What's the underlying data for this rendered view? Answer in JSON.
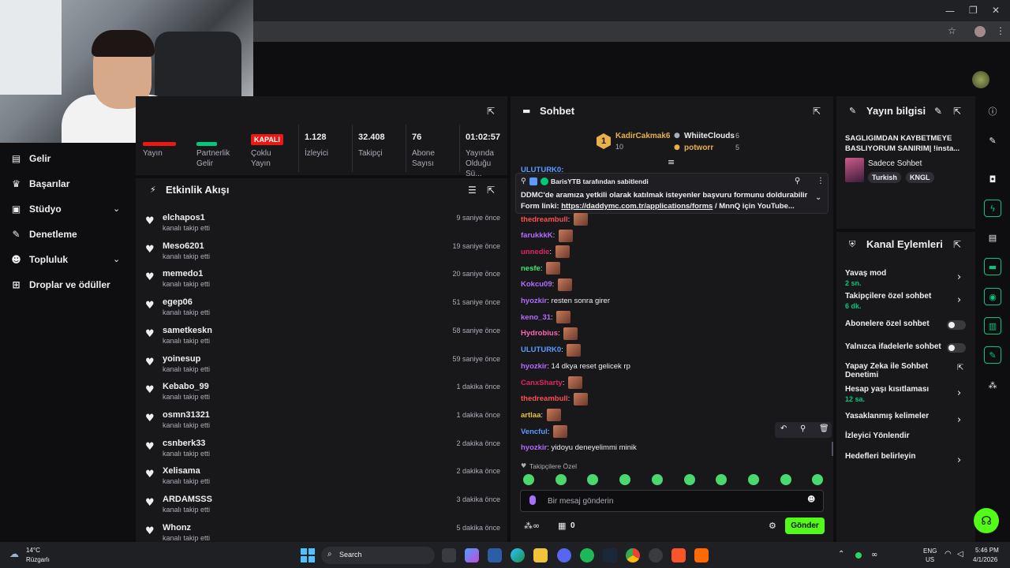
{
  "colors": {
    "accent": "#00c97b",
    "live_red": "#e91916",
    "bg": "#0e0e10",
    "panel": "#18181b"
  },
  "sidebar": {
    "items": [
      {
        "label": "Gelir",
        "icon": "revenue-icon"
      },
      {
        "label": "Başarılar",
        "icon": "trophy-icon"
      },
      {
        "label": "Stüdyo",
        "icon": "studio-icon"
      },
      {
        "label": "Denetleme",
        "icon": "wrench-icon"
      },
      {
        "label": "Topluluk",
        "icon": "community-icon"
      },
      {
        "label": "Droplar ve ödüller",
        "icon": "drops-icon"
      }
    ]
  },
  "stats": {
    "items": [
      {
        "value": "",
        "label": "Yayın"
      },
      {
        "value": "",
        "label": "Partnerlik Gelir"
      },
      {
        "value": "KAPALI",
        "label": "Çoklu Yayın"
      },
      {
        "value": "1.128",
        "label": "İzleyici"
      },
      {
        "value": "32.408",
        "label": "Takipçi"
      },
      {
        "value": "76",
        "label": "Abone Sayısı"
      },
      {
        "value": "01:02:57",
        "label": "Yayında Olduğu Sü..."
      }
    ]
  },
  "activity": {
    "title": "Etkinlik Akışı",
    "rows": [
      {
        "user": "elchapos1",
        "action": "kanalı takip etti",
        "time": "9 saniye önce"
      },
      {
        "user": "Meso6201",
        "action": "kanalı takip etti",
        "time": "19 saniye önce"
      },
      {
        "user": "memedo1",
        "action": "kanalı takip etti",
        "time": "20 saniye önce"
      },
      {
        "user": "egep06",
        "action": "kanalı takip etti",
        "time": "51 saniye önce"
      },
      {
        "user": "sametkeskn",
        "action": "kanalı takip etti",
        "time": "58 saniye önce"
      },
      {
        "user": "yoinesup",
        "action": "kanalı takip etti",
        "time": "59 saniye önce"
      },
      {
        "user": "Kebabo_99",
        "action": "kanalı takip etti",
        "time": "1 dakika önce"
      },
      {
        "user": "osmn31321",
        "action": "kanalı takip etti",
        "time": "1 dakika önce"
      },
      {
        "user": "csnberk33",
        "action": "kanalı takip etti",
        "time": "2 dakika önce"
      },
      {
        "user": "Xelisama",
        "action": "kanalı takip etti",
        "time": "2 dakika önce"
      },
      {
        "user": "ARDAMSSS",
        "action": "kanalı takip etti",
        "time": "3 dakika önce"
      },
      {
        "user": "Whonz",
        "action": "kanalı takip etti",
        "time": "5 dakika önce"
      }
    ]
  },
  "chat": {
    "title": "Sohbet",
    "leaderboard": [
      {
        "rank": "1",
        "name": "KadirCakmak6",
        "count": "10"
      },
      {
        "rank": "",
        "name": "WhiiteClouds",
        "count": "6"
      },
      {
        "rank": "",
        "name": "potworr",
        "count": "5"
      }
    ],
    "pinned": {
      "by": "BarisYTB tarafından sabitlendi",
      "line1": "DDMC'de aramıza yetkili olarak katılmak isteyenler başvuru formunu doldurabilir",
      "prefix": "Form linki: ",
      "link": "https://daddymc.com.tr/applications/forms",
      "suffix": " / MnnQ için YouTube..."
    },
    "hidden_top_user": "ULUTURK0:",
    "messages": [
      {
        "user": "thedreambull",
        "color": "#ff4f4f",
        "text": "",
        "emote": true
      },
      {
        "user": "farukkkK",
        "color": "#b26cff",
        "text": "",
        "emote": true
      },
      {
        "user": "unnedie",
        "color": "#e0245e",
        "text": "",
        "emote": true
      },
      {
        "user": "nesfe",
        "color": "#3be86a",
        "text": "",
        "emote": true
      },
      {
        "user": "Kokcu09",
        "color": "#b26cff",
        "text": "",
        "emote": true
      },
      {
        "user": "hyozkir",
        "color": "#b26cff",
        "text": "resten sonra girer",
        "emote": false
      },
      {
        "user": "keno_31",
        "color": "#b26cff",
        "text": "",
        "emote": true
      },
      {
        "user": "Hydrobius",
        "color": "#ff66b2",
        "text": "",
        "emote": true
      },
      {
        "user": "ULUTURK0",
        "color": "#5b9bff",
        "text": "",
        "emote": true
      },
      {
        "user": "hyozkir",
        "color": "#b26cff",
        "text": "14 dkya reset gelicek rp",
        "emote": false
      },
      {
        "user": "CanxSharty",
        "color": "#e0245e",
        "text": "",
        "emote": true
      },
      {
        "user": "thedreambull",
        "color": "#ff4f4f",
        "text": "",
        "emote": true
      },
      {
        "user": "artlaa",
        "color": "#e8c43b",
        "text": "",
        "emote": true
      },
      {
        "user": "Vencful",
        "color": "#5b9bff",
        "text": "",
        "emote": true
      },
      {
        "user": "hyozkir",
        "color": "#b26cff",
        "text": "yidoyu deneyelimmi minik",
        "emote": false
      }
    ],
    "followers_only": "Takipçilere Özel",
    "input_placeholder": "Bir mesaj gönderin",
    "bottom_count": "0",
    "send_label": "Gönder"
  },
  "stream_info": {
    "title": "Yayın bilgisi",
    "stream_title": "SAGLIGIMDAN KAYBETMEYE BASLIYORUM SANIRIM| !insta...",
    "category": "Sadece Sohbet",
    "tags": [
      "Turkish",
      "KNGL"
    ]
  },
  "channel_actions": {
    "title": "Kanal Eylemleri",
    "items": [
      {
        "label": "Yavaş mod",
        "sub": "2 sn.",
        "control": "arrow"
      },
      {
        "label": "Takipçilere özel sohbet",
        "sub": "6 dk.",
        "control": "arrow"
      },
      {
        "label": "Abonelere özel sohbet",
        "sub": "",
        "control": "toggle"
      },
      {
        "label": "Yalnızca ifadelerle sohbet",
        "sub": "",
        "control": "toggle"
      },
      {
        "label": "Yapay Zeka ile Sohbet Denetimi",
        "sub": "",
        "control": "external"
      },
      {
        "label": "Hesap yaşı kısıtlaması",
        "sub": "12 sa.",
        "control": "arrow"
      },
      {
        "label": "Yasaklanmış kelimeler",
        "sub": "",
        "control": "arrow"
      },
      {
        "label": "İzleyici Yönlendir",
        "sub": "",
        "control": "none"
      },
      {
        "label": "Hedefleri belirleyin",
        "sub": "",
        "control": "arrow"
      }
    ]
  },
  "taskbar": {
    "weather_temp": "14°C",
    "weather_desc": "Rüzgarlı",
    "search_placeholder": "Search",
    "lang": "ENG",
    "region": "US",
    "time": "5:46 PM",
    "date": "4/1/2026"
  }
}
